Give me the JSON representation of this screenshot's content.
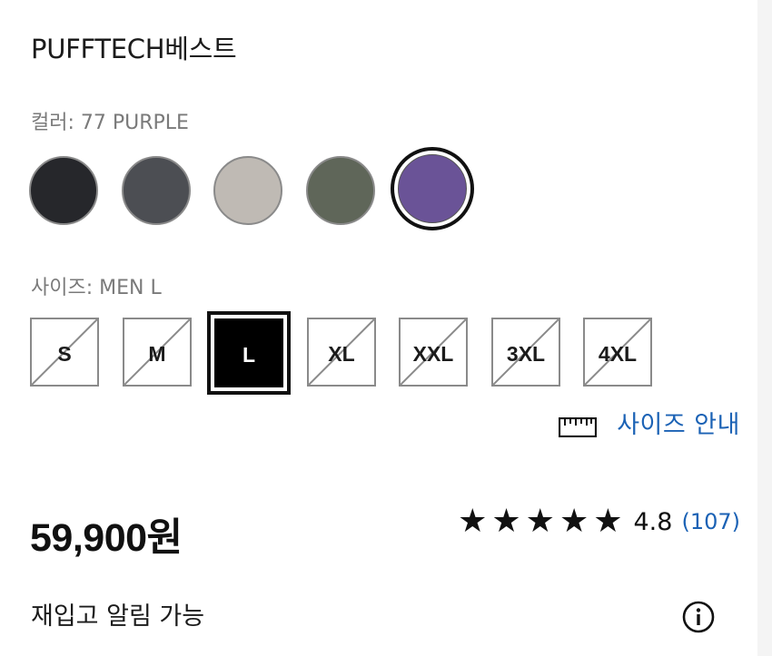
{
  "product": {
    "title": "PUFFTECH베스트"
  },
  "color": {
    "label": "컬러",
    "separator": ": ",
    "selected_value": "77 PURPLE",
    "swatches": [
      {
        "hex": "#26272b"
      },
      {
        "hex": "#4c4e53"
      },
      {
        "hex": "#bfbab4"
      },
      {
        "hex": "#5f6659"
      },
      {
        "hex": "#6a5397",
        "selected": true
      }
    ]
  },
  "size": {
    "label": "사이즈",
    "separator": ": ",
    "selected_value": "MEN L",
    "options": [
      {
        "label": "S",
        "available": false
      },
      {
        "label": "M",
        "available": false
      },
      {
        "label": "L",
        "available": true,
        "selected": true
      },
      {
        "label": "XL",
        "available": false
      },
      {
        "label": "XXL",
        "available": false
      },
      {
        "label": "3XL",
        "available": false
      },
      {
        "label": "4XL",
        "available": false
      }
    ],
    "guide_label": "사이즈 안내",
    "guide_icon": "ruler-icon"
  },
  "pricing": {
    "price": "59,900원"
  },
  "rating": {
    "stars": 5,
    "score": "4.8",
    "count": "(107)"
  },
  "restock": {
    "label": "재입고 알림 가능",
    "icon": "info-icon"
  },
  "colors": {
    "link": "#1b62b5",
    "text": "#1b1b1b",
    "muted": "#7a7a7a"
  }
}
